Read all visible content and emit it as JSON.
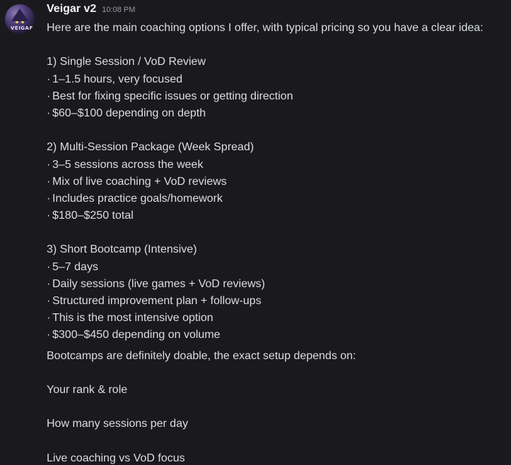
{
  "message": {
    "author": "Veigar v2",
    "timestamp": "10:08 PM",
    "avatar_icon": "veigar-avatar-icon",
    "avatar_text": "VEIGAR",
    "intro": "Here are the main coaching options I offer, with typical pricing so you have a clear idea:",
    "options": [
      {
        "title": "1) Single Session / VoD Review",
        "bullets": [
          "1–1.5 hours, very focused",
          "Best for fixing specific issues or getting direction",
          "$60–$100 depending on depth"
        ]
      },
      {
        "title": "2) Multi-Session Package (Week Spread)",
        "bullets": [
          "3–5 sessions across the week",
          "Mix of live coaching + VoD reviews",
          "Includes practice goals/homework",
          "$180–$250 total"
        ]
      },
      {
        "title": "3) Short Bootcamp (Intensive)",
        "bullets": [
          "5–7 days",
          "Daily sessions (live games + VoD reviews)",
          "Structured improvement plan + follow-ups",
          "This is the most intensive option",
          "$300–$450 depending on volume"
        ]
      }
    ],
    "followup": "Bootcamps are definitely doable, the exact setup depends on:",
    "factors": [
      "Your rank & role",
      "How many sessions per day",
      "Live coaching vs VoD focus"
    ]
  }
}
